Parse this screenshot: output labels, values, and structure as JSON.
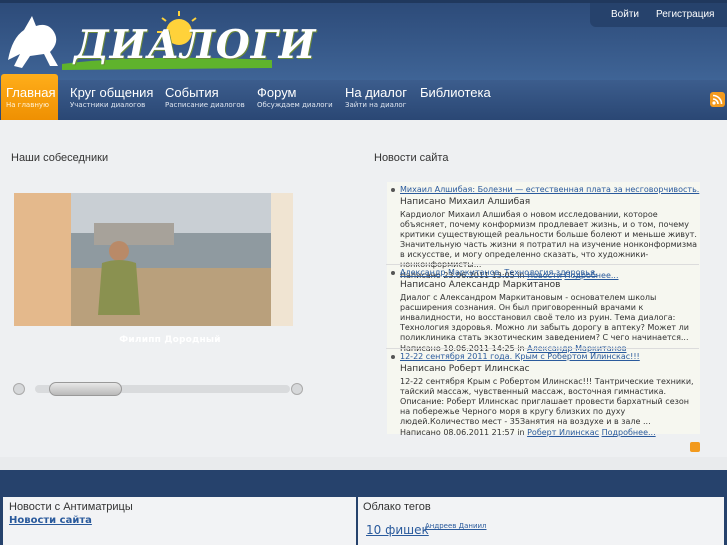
{
  "site": {
    "logo_text": "ДИАЛОГИ"
  },
  "user": {
    "login": "Войти",
    "register": "Регистрация"
  },
  "nav": [
    {
      "title": "Главная",
      "sub": "На главную",
      "active": true
    },
    {
      "title": "Круг общения",
      "sub": "Участники диалогов"
    },
    {
      "title": "События",
      "sub": "Расписание диалогов"
    },
    {
      "title": "Форум",
      "sub": "Обсуждаем диалоги"
    },
    {
      "title": "На диалог",
      "sub": "Зайти на диалог"
    },
    {
      "title": "Библиотека",
      "sub": ""
    }
  ],
  "left": {
    "title": "Наши собеседники",
    "person_name": "Филипп Дородный"
  },
  "right": {
    "title": "Новости сайта",
    "items": [
      {
        "headline": "Михаил Алшибая: Болезни — естественная плата за несговорчивость.",
        "author": "Написано Михаил Алшибая",
        "text": "Кардиолог Михаил Алшибая о новом исследовании, которое объясняет, почему конформизм продлевает жизнь, и о том, почему критики существующей реальности больше болеют и меньше живут. Значительную часть жизни я потратил на изучение нонконформизма в искусстве, и могу определенно сказать, что художники-нонконформисты...",
        "meta": "Написано 23.06.2011 13:05 in",
        "category": "Новости",
        "more": "Подробнее..."
      },
      {
        "headline": "Александр Маркитанов. Технология здоровья.",
        "author": "Написано Александр Маркитанов",
        "text": "Диалог с Александром Маркитановым - основателем школы расширения сознания. Он был приговоренный врачами к инвалидности, но восстановил своё тело из руин. Тема диалога: Технология здоровья. Можно ли забыть дорогу в аптеку? Может ли поликлиника стать экзотическим заведением? С чего начинается...",
        "meta": "Написано 10.06.2011 14:25 in",
        "category": "Александр Маркитанов",
        "more": ""
      },
      {
        "headline": "12-22 сентября 2011 года. Крым с Робертом Илинскас!!!",
        "author": "Написано Роберт Илинскас",
        "text": "12-22 сентября Крым с Робертом Илинскас!!! Тантрические техники, тайский массаж, чувственный массаж, восточная гимнастика. Описание: Роберт Илинскас приглашает провести бархатный сезон на побережье Черного моря в кругу близких по духу людей.Количество мест - 35Занятия на воздухе и в зале ...",
        "meta": "Написано 08.06.2011 21:57 in",
        "category": "Роберт Илинскас",
        "more": "Подробнее..."
      }
    ]
  },
  "footer": {
    "box1_title": "Новости с Антиматрицы",
    "box1_link": "Новости сайта",
    "box2_title": "Облако тегов",
    "tag1": "10 фишек",
    "tag2": "Андреев Даниил"
  },
  "colors": {
    "header": "#2c4a78",
    "active_tab": "#f39a0c",
    "link": "#2a5a9c"
  }
}
